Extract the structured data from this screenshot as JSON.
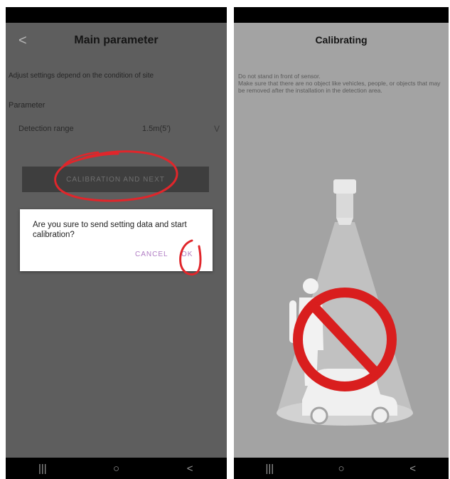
{
  "left_screen": {
    "header": {
      "back_icon": "chevron-left-icon",
      "back_glyph": "<",
      "title": "Main parameter"
    },
    "subtitle": "Adjust settings depend on the condition of site",
    "section_label": "Parameter",
    "parameter": {
      "name": "Detection range",
      "value": "1.5m(5')",
      "chevron_glyph": "V"
    },
    "calibration_button": {
      "label": "CALIBRATION AND NEXT"
    },
    "dialog": {
      "message": "Are you sure to send setting data and start calibration?",
      "cancel_label": "CANCEL",
      "ok_label": "OK"
    }
  },
  "right_screen": {
    "title": "Calibrating",
    "instruction": "Do not stand in front of sensor.\n Make sure that there are no object like vehicles, people, or objects that may be removed after the installation in the detection area.",
    "illustration_icons": [
      "sensor-icon",
      "person-icon",
      "car-icon",
      "prohibited-icon"
    ]
  },
  "nav_bar": {
    "recents_glyph": "|||",
    "home_glyph": "○",
    "back_glyph": "<"
  },
  "colors": {
    "left_background": "#5e5e5e",
    "right_background": "#a3a3a3",
    "dialog_action": "#b07cc3",
    "annotation_red": "#e0262b",
    "prohibited_red": "#d91e1e"
  }
}
